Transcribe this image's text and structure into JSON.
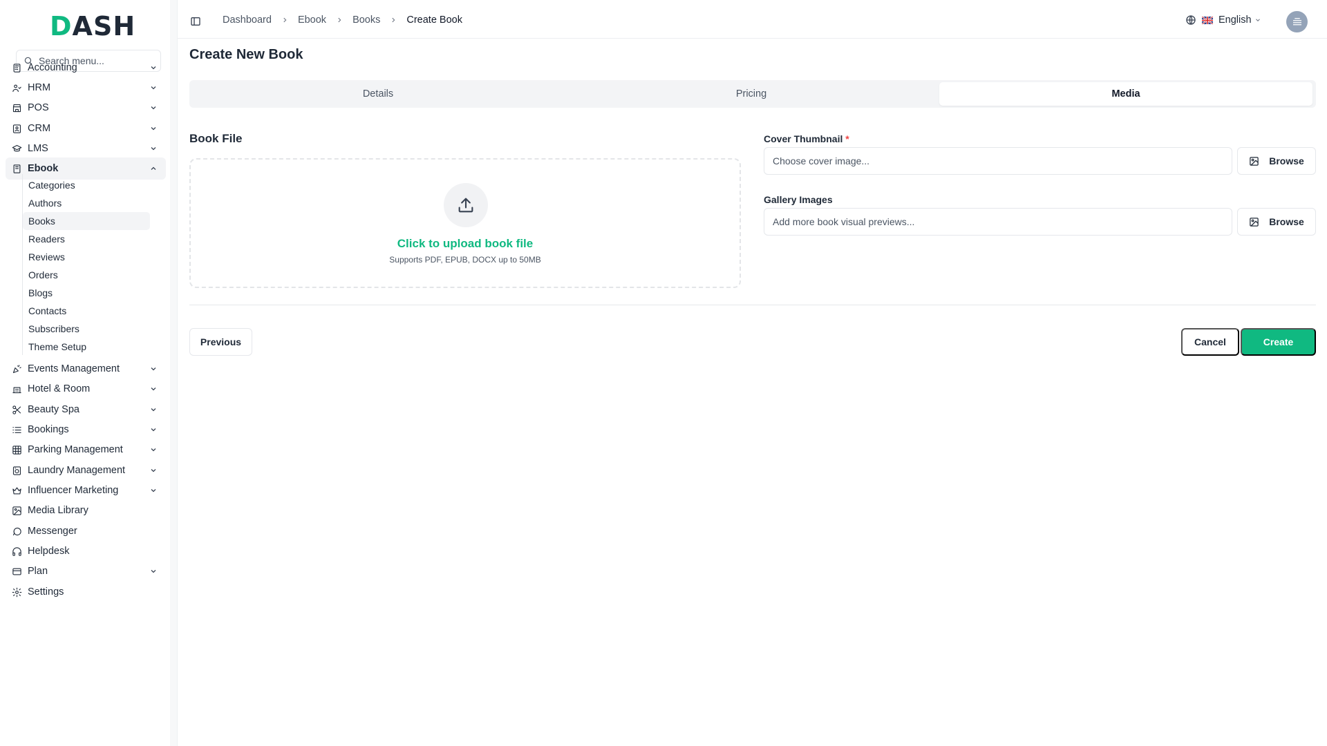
{
  "app": {
    "logo_prefix": "D",
    "logo_rest": "ASH",
    "brand_color": "#10b981"
  },
  "search": {
    "placeholder": "Search menu..."
  },
  "sidebar": {
    "items": [
      {
        "label": "Accounting",
        "icon": "calculator-icon",
        "has_chevron": true
      },
      {
        "label": "HRM",
        "icon": "users-icon",
        "has_chevron": true
      },
      {
        "label": "POS",
        "icon": "store-icon",
        "has_chevron": true
      },
      {
        "label": "CRM",
        "icon": "contacts-icon",
        "has_chevron": true
      },
      {
        "label": "LMS",
        "icon": "graduation-cap-icon",
        "has_chevron": true
      },
      {
        "label": "Ebook",
        "icon": "book-icon",
        "has_chevron": true,
        "expanded": true
      },
      {
        "label": "Events Management",
        "icon": "party-popper-icon",
        "has_chevron": true
      },
      {
        "label": "Hotel & Room",
        "icon": "hotel-icon",
        "has_chevron": true
      },
      {
        "label": "Beauty Spa",
        "icon": "scissors-icon",
        "has_chevron": true
      },
      {
        "label": "Bookings",
        "icon": "list-icon",
        "has_chevron": true
      },
      {
        "label": "Parking Management",
        "icon": "grid-icon",
        "has_chevron": true
      },
      {
        "label": "Laundry Management",
        "icon": "washing-machine-icon",
        "has_chevron": true
      },
      {
        "label": "Influencer Marketing",
        "icon": "crown-icon",
        "has_chevron": true
      },
      {
        "label": "Media Library",
        "icon": "image-icon",
        "has_chevron": false
      },
      {
        "label": "Messenger",
        "icon": "message-circle-icon",
        "has_chevron": false
      },
      {
        "label": "Helpdesk",
        "icon": "headphones-icon",
        "has_chevron": false
      },
      {
        "label": "Plan",
        "icon": "credit-card-icon",
        "has_chevron": true
      },
      {
        "label": "Settings",
        "icon": "gear-icon",
        "has_chevron": false
      }
    ],
    "ebook_children": [
      {
        "label": "Categories"
      },
      {
        "label": "Authors"
      },
      {
        "label": "Books",
        "active": true
      },
      {
        "label": "Readers"
      },
      {
        "label": "Reviews"
      },
      {
        "label": "Orders"
      },
      {
        "label": "Blogs"
      },
      {
        "label": "Contacts"
      },
      {
        "label": "Subscribers"
      },
      {
        "label": "Theme Setup"
      }
    ]
  },
  "topbar": {
    "breadcrumbs": [
      "Dashboard",
      "Ebook",
      "Books",
      "Create Book"
    ],
    "language": "English"
  },
  "page": {
    "title": "Create New Book",
    "tabs": [
      {
        "label": "Details",
        "active": false
      },
      {
        "label": "Pricing",
        "active": false
      },
      {
        "label": "Media",
        "active": true
      }
    ],
    "book_file": {
      "label": "Book File",
      "upload_title": "Click to upload book file",
      "upload_subtitle": "Supports PDF, EPUB, DOCX up to 50MB"
    },
    "cover_thumbnail": {
      "label": "Cover Thumbnail",
      "required_mark": "*",
      "placeholder": "Choose cover image...",
      "value": "",
      "button": "Browse"
    },
    "gallery_images": {
      "label": "Gallery Images",
      "placeholder": "Add more book visual previews...",
      "value": "",
      "button": "Browse"
    },
    "actions": {
      "previous": "Previous",
      "cancel": "Cancel",
      "create": "Create"
    }
  }
}
